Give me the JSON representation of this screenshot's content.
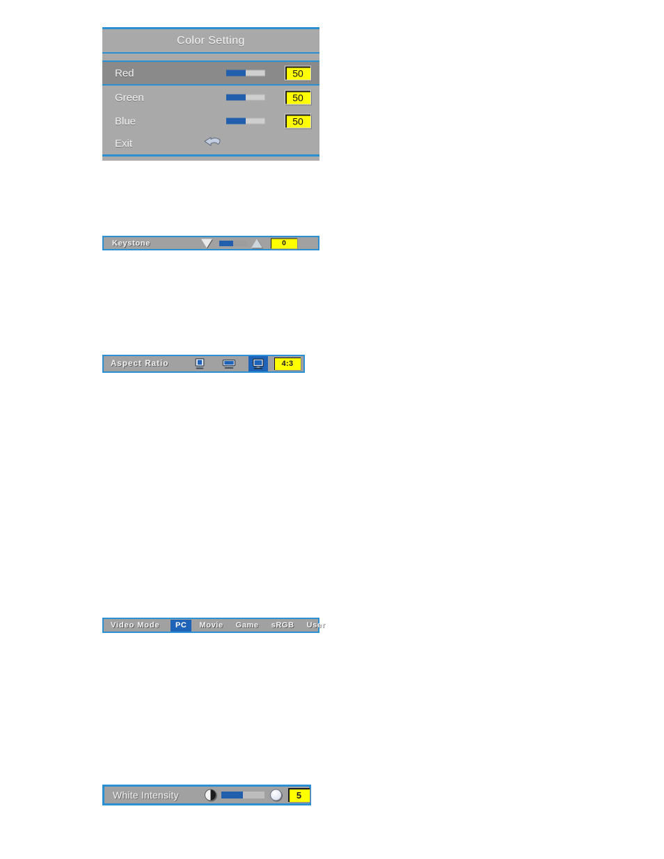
{
  "color_setting": {
    "title": "Color Setting",
    "rows": [
      {
        "label": "Red",
        "value": "50",
        "fill_percent": 50,
        "selected": true
      },
      {
        "label": "Green",
        "value": "50",
        "fill_percent": 50,
        "selected": false
      },
      {
        "label": "Blue",
        "value": "50",
        "fill_percent": 50,
        "selected": false
      }
    ],
    "exit": {
      "label": "Exit",
      "icon": "return-arrow-icon"
    },
    "colors": {
      "panel_bg": "#a9a9a9",
      "row_selected_bg": "#8a8a8a",
      "border_blue": "#2b8fd4",
      "slider_fill": "#215fad",
      "value_bg": "#ffff00"
    }
  },
  "keystone": {
    "label": "Keystone",
    "value": "0",
    "fill_percent": 50,
    "decrease_icon": "triangle-down-icon",
    "increase_icon": "triangle-up-icon"
  },
  "aspect_ratio": {
    "label": "Aspect Ratio",
    "value": "4:3",
    "options": [
      {
        "icon": "monitor-4-3-icon",
        "selected": false
      },
      {
        "icon": "monitor-16-9-icon",
        "selected": false
      },
      {
        "icon": "monitor-original-icon",
        "selected": true
      }
    ]
  },
  "video_mode": {
    "label": "Video Mode",
    "options": [
      {
        "label": "PC",
        "selected": true
      },
      {
        "label": "Movie",
        "selected": false
      },
      {
        "label": "Game",
        "selected": false
      },
      {
        "label": "sRGB",
        "selected": false
      },
      {
        "label": "User",
        "selected": false
      }
    ]
  },
  "white_intensity": {
    "label": "White Intensity",
    "value": "5",
    "fill_percent": 50,
    "left_icon": "contrast-circle-icon",
    "right_icon": "brightness-circle-icon"
  }
}
